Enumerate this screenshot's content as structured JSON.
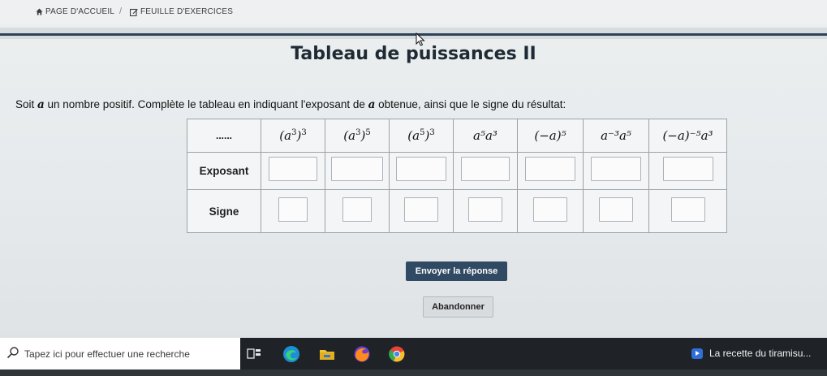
{
  "breadcrumb": {
    "home_label": "PAGE D'ACCUEIL",
    "separator": "/",
    "sheet_label": "FEUILLE D'EXERCICES"
  },
  "page_title": "Tableau de puissances II",
  "instruction": {
    "before": "Soit ",
    "variable": "a",
    "middle": " un nombre positif. Complète le tableau en indiquant l'exposant de ",
    "variable2": "a",
    "after": " obtenue, ainsi que le signe du résultat:"
  },
  "table": {
    "corner_label": "......",
    "columns": [
      {
        "base": "(a",
        "exp_inner": "3",
        "close": ")",
        "exp_outer": "3"
      },
      {
        "base": "(a",
        "exp_inner": "3",
        "close": ")",
        "exp_outer": "5"
      },
      {
        "base": "(a",
        "exp_inner": "5",
        "close": ")",
        "exp_outer": "3"
      },
      {
        "text": "a⁵a³"
      },
      {
        "text": "(−a)⁵"
      },
      {
        "text": "a⁻³a⁵"
      },
      {
        "text": "(−a)⁻⁵a³"
      }
    ],
    "row_labels": [
      "Exposant",
      "Signe"
    ]
  },
  "buttons": {
    "submit": "Envoyer la réponse",
    "abandon": "Abandonner"
  },
  "taskbar": {
    "search_placeholder": "Tapez ici pour effectuer une recherche",
    "news_text": "La recette du tiramisu..."
  },
  "colors": {
    "accent_dark": "#314a63",
    "header_line": "#2d4257",
    "taskbar": "#1f2327"
  }
}
